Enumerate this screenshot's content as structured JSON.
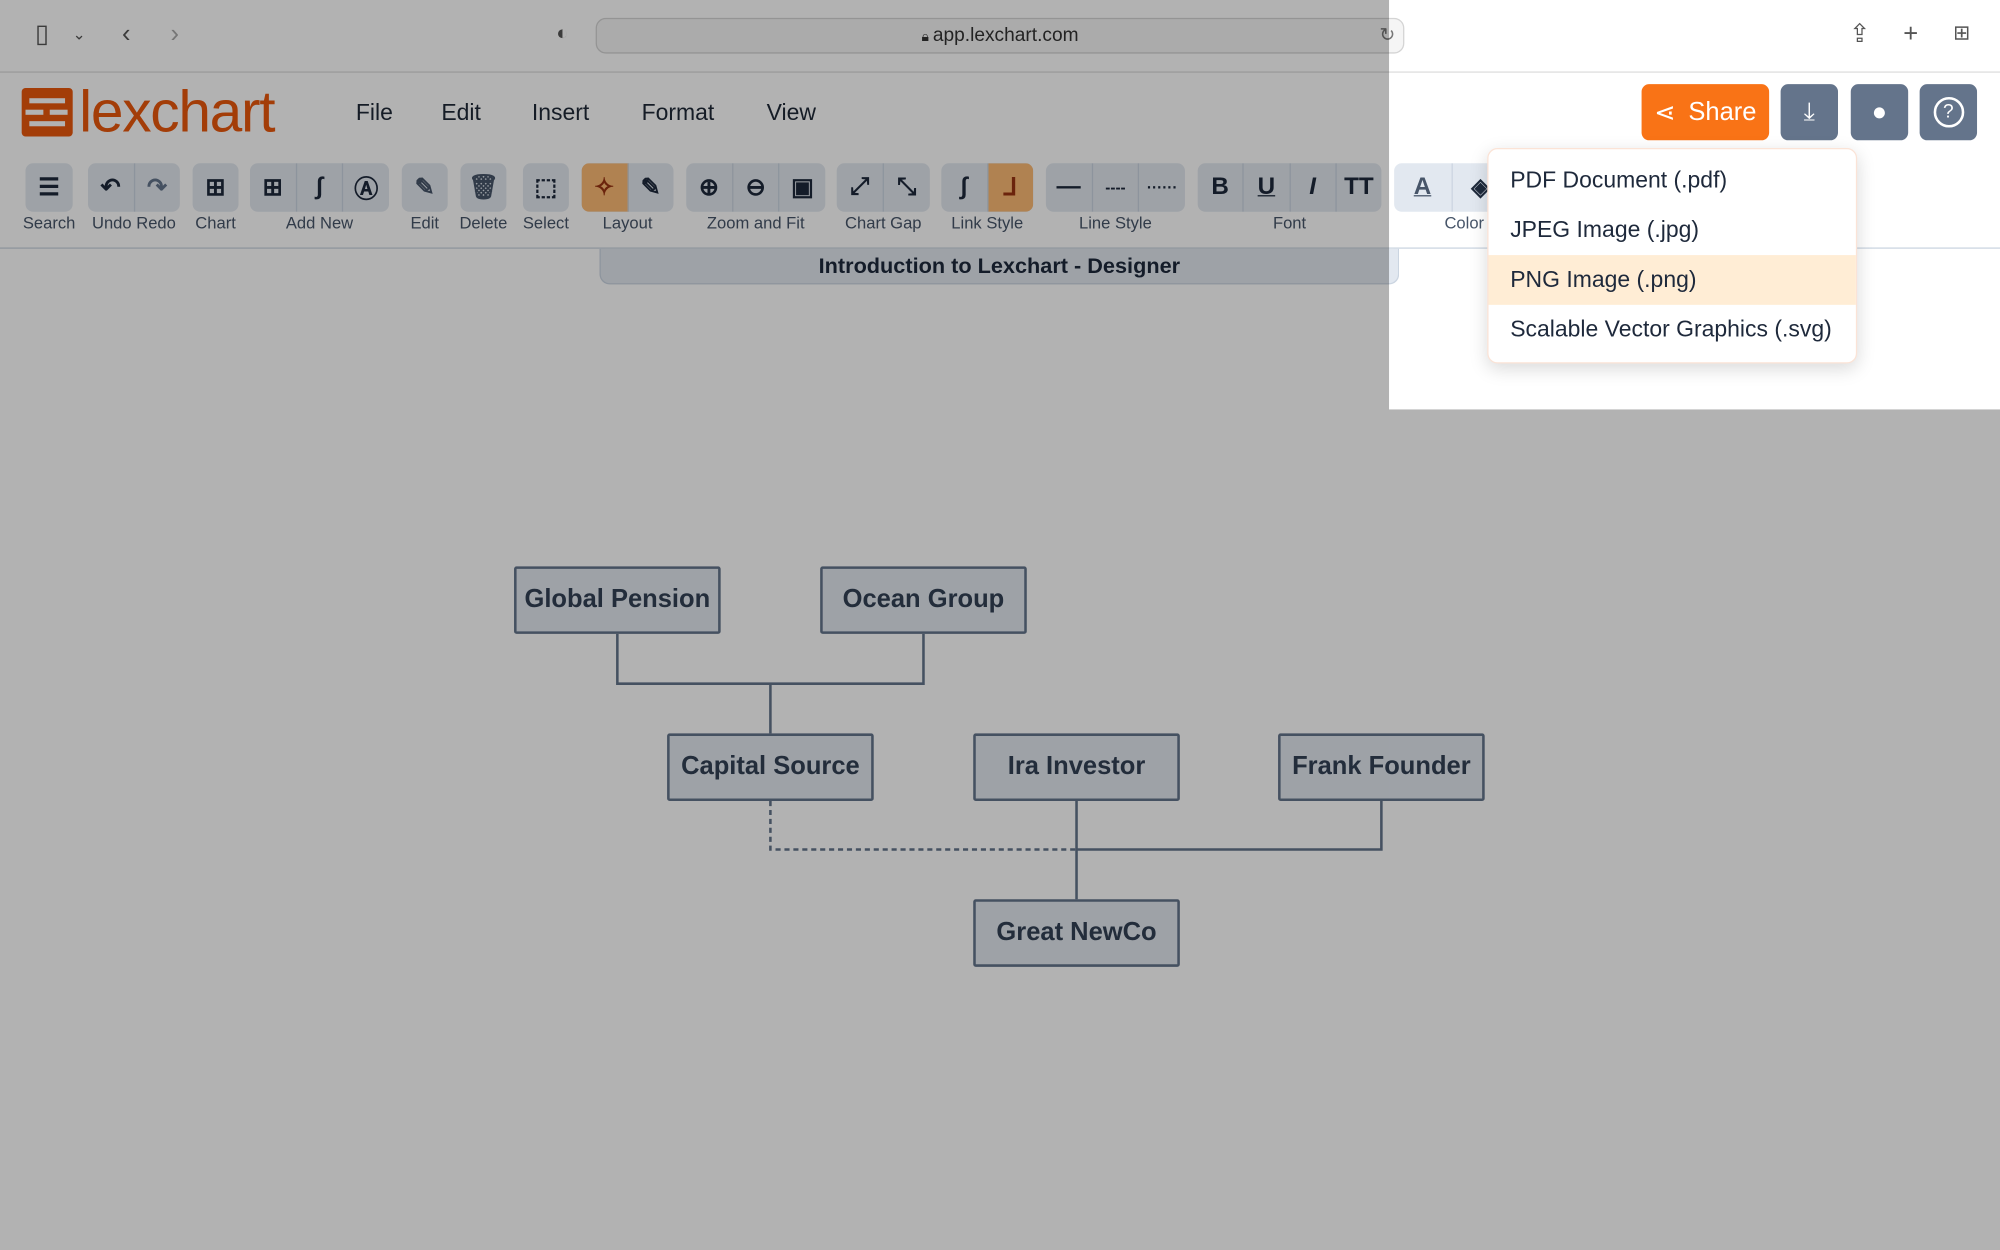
{
  "browser": {
    "url": "app.lexchart.com",
    "icons": [
      "sidebar-icon",
      "chevron-down-icon",
      "back-icon",
      "forward-icon",
      "shield-icon",
      "lock-icon",
      "reload-icon",
      "share-icon",
      "plus-icon",
      "tabs-grid-icon"
    ]
  },
  "app": {
    "logo": "lexchart",
    "brand_color": "#ea580c",
    "accent_color": "#f97316"
  },
  "menu": [
    "File",
    "Edit",
    "Insert",
    "Format",
    "View"
  ],
  "header_buttons": {
    "share": "Share"
  },
  "toolbar": [
    {
      "label": "Search"
    },
    {
      "label": "Undo Redo"
    },
    {
      "label": "Chart"
    },
    {
      "label": "Add New"
    },
    {
      "label": "Edit"
    },
    {
      "label": "Delete"
    },
    {
      "label": "Select"
    },
    {
      "label": "Layout"
    },
    {
      "label": "Zoom and Fit"
    },
    {
      "label": "Chart Gap"
    },
    {
      "label": "Link Style"
    },
    {
      "label": "Line Style"
    },
    {
      "label": "Font"
    },
    {
      "label": "Color"
    }
  ],
  "font_buttons": [
    "B",
    "U",
    "I",
    "TT"
  ],
  "document_title": "Introduction to Lexchart - Designer",
  "download_menu": {
    "items": [
      "PDF Document (.pdf)",
      "JPEG Image (.jpg)",
      "PNG Image (.png)",
      "Scalable Vector Graphics (.svg)"
    ],
    "highlighted": "PNG Image (.png)"
  },
  "nodes": [
    "Global Pension",
    "Ocean Group",
    "Capital Source",
    "Ira Investor",
    "Frank Founder",
    "Great NewCo"
  ]
}
